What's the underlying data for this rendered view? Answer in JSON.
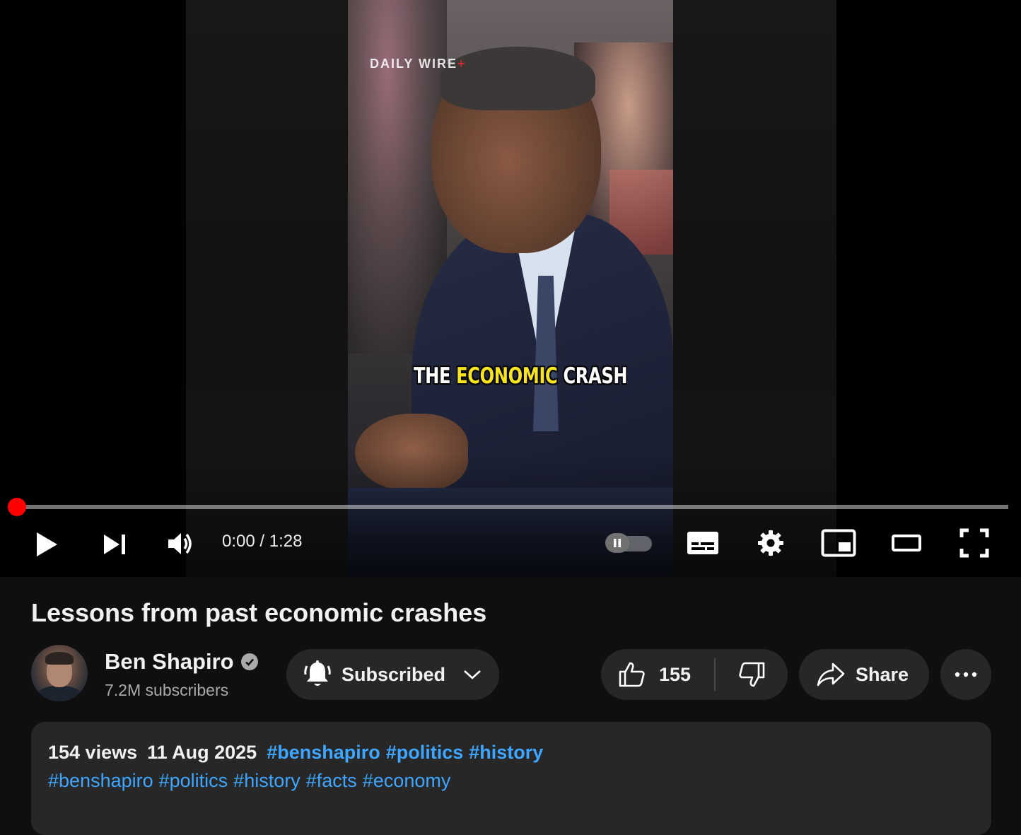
{
  "player": {
    "watermark_text": "DAILY WIRE",
    "watermark_plus": "+",
    "caption": {
      "word1": "THE",
      "word2": "ECONOMIC",
      "word3": "CRASH"
    },
    "progress_fraction": 0.0,
    "time_current": "0:00",
    "time_separator": " / ",
    "time_total": "1:28",
    "autoplay_state": "paused",
    "accent_color": "#ff0000",
    "icons": [
      "play-icon",
      "next-icon",
      "volume-icon",
      "autoplay-toggle",
      "subtitles-icon",
      "settings-icon",
      "miniplayer-icon",
      "theater-mode-icon",
      "fullscreen-icon"
    ]
  },
  "video": {
    "title": "Lessons from past economic crashes"
  },
  "channel": {
    "name": "Ben Shapiro",
    "verified": true,
    "subscribers": "7.2M subscribers"
  },
  "actions": {
    "subscribe_label": "Subscribed",
    "like_count": "155",
    "share_label": "Share"
  },
  "description": {
    "views": "154 views",
    "date": "11 Aug 2025",
    "top_hashtags": [
      "#benshapiro",
      "#politics",
      "#history"
    ],
    "body_hashtags": [
      "#benshapiro",
      "#politics",
      "#history",
      "#facts",
      "#economy"
    ],
    "link_color": "#3ea6ff"
  }
}
